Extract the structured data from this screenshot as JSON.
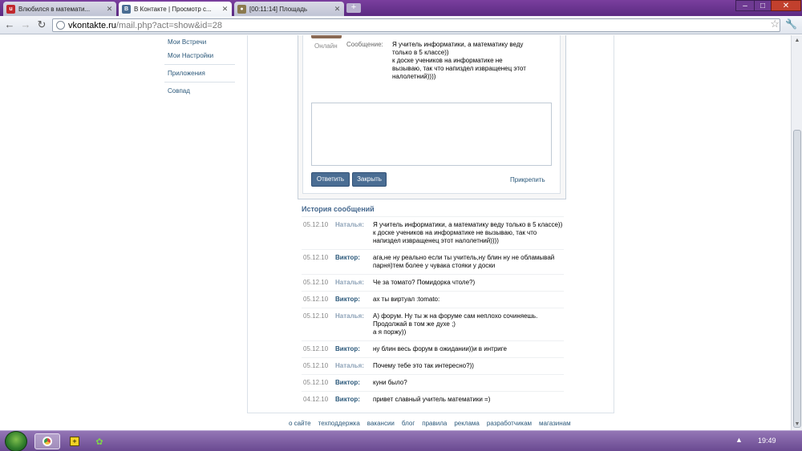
{
  "browser": {
    "tabs": [
      {
        "label": "Влюбился в математи...",
        "favicon": "livejournal-icon",
        "favicon_color": "#c1272d",
        "active": false
      },
      {
        "label": "В Контакте | Просмотр с...",
        "favicon": "vk-icon",
        "favicon_color": "#4a6d93",
        "active": true
      },
      {
        "label": "[00:11:14] Площадь",
        "favicon": "poop-icon",
        "favicon_color": "#8b7a4e",
        "active": false
      }
    ],
    "new_tab_label": "+",
    "url_host": "vkontakte.ru",
    "url_path": "/mail.php?act=show&id=28"
  },
  "sidebar": {
    "items": [
      {
        "label": "Мои Встречи"
      },
      {
        "label": "Мои Настройки"
      },
      {
        "label": "Приложения"
      },
      {
        "label": "Совпад"
      }
    ]
  },
  "message": {
    "online_label": "Онлайн",
    "field_label": "Сообщение:",
    "text_lines": [
      "Я учитель информатики, а математику веду",
      "только в 5 классе))",
      "к доске учеников на информатике не",
      "вызываю, так что напиздел извращенец этот",
      "налолетний))))"
    ],
    "reply_placeholder": "",
    "reply_button": "Ответить",
    "close_button": "Закрыть",
    "attach_link": "Прикрепить"
  },
  "history": {
    "title": "История сообщений",
    "rows": [
      {
        "date": "05.12.10",
        "author": "Наталья:",
        "author_type": "n",
        "lines": [
          "Я учитель информатики, а математику веду только в 5 классе))",
          "к доске учеников на информатике не вызываю, так что",
          "напиздел извращенец этот налолетний))))"
        ]
      },
      {
        "date": "05.12.10",
        "author": "Виктор:",
        "author_type": "v",
        "lines": [
          "ага,не ну реально если ты учитель,ну блин ну не обламывай",
          "парня)тем более у чувака стояки у доски"
        ]
      },
      {
        "date": "05.12.10",
        "author": "Наталья:",
        "author_type": "n",
        "lines": [
          "Че за томато? Помидорка чтоле?)"
        ]
      },
      {
        "date": "05.12.10",
        "author": "Виктор:",
        "author_type": "v",
        "lines": [
          "ах ты виртуал :tomato:"
        ]
      },
      {
        "date": "05.12.10",
        "author": "Наталья:",
        "author_type": "n",
        "lines": [
          "А) форум. Ну ты ж на форуме сам неплохо сочиняешь.",
          "Продолжай в том же духе ;)",
          "а я поржу))"
        ]
      },
      {
        "date": "05.12.10",
        "author": "Виктор:",
        "author_type": "v",
        "lines": [
          "ну блин весь форум в ожидании))и в интриге"
        ]
      },
      {
        "date": "05.12.10",
        "author": "Наталья:",
        "author_type": "n",
        "lines": [
          "Почему тебе это так интересно?))"
        ]
      },
      {
        "date": "05.12.10",
        "author": "Виктор:",
        "author_type": "v",
        "lines": [
          "куни было?"
        ]
      },
      {
        "date": "04.12.10",
        "author": "Виктор:",
        "author_type": "v",
        "lines": [
          "привет славный учитель математики =)"
        ]
      }
    ]
  },
  "footer": {
    "links": [
      "о сайте",
      "техподдержка",
      "вакансии",
      "блог",
      "правила",
      "реклама",
      "разработчикам",
      "магазинам"
    ]
  },
  "taskbar": {
    "clock": "19:49"
  },
  "colors": {
    "vk_link": "#2b587a",
    "vk_button": "#4a6d93",
    "history_title": "#45688e"
  }
}
